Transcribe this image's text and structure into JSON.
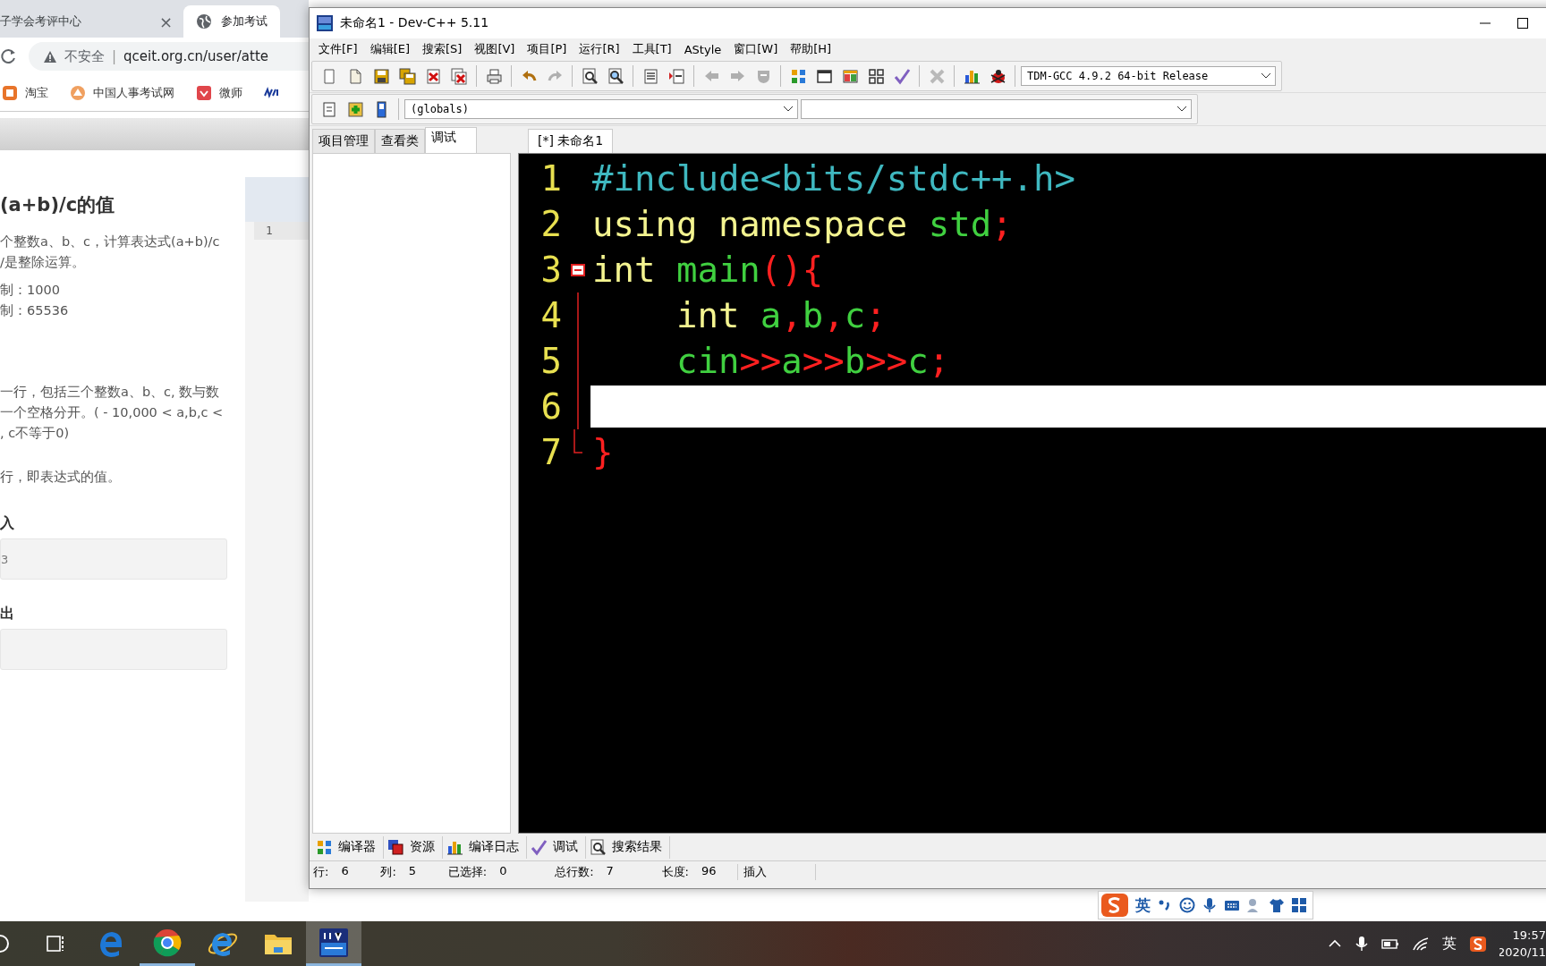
{
  "browser": {
    "tabs": [
      {
        "label": "子学会考评中心",
        "close": "×",
        "selected": false
      },
      {
        "label": "参加考试",
        "selected": true
      }
    ],
    "address": {
      "security": "不安全",
      "separator": "|",
      "url": "qceit.org.cn/user/atte"
    },
    "bookmarks": [
      "淘宝",
      "中国人事考试网",
      "微师"
    ],
    "problem": {
      "title": "(a+b)/c的值",
      "description": [
        "个整数a、b、c，计算表达式(a+b)/c",
        "/是整除运算。"
      ],
      "limits": [
        "制：1000",
        "制：65536"
      ],
      "input_description": [
        "一行，包括三个整数a、b、c, 数与数",
        "一个空格分开。( - 10,000 < a,b,c <",
        ", c不等于0)"
      ],
      "output_description": [
        "行，即表达式的值。"
      ],
      "sample_input": {
        "heading": "入",
        "value": "3"
      },
      "sample_output": {
        "heading": "出"
      }
    },
    "side_editor": {
      "line_numbers": [
        "1"
      ]
    }
  },
  "devcpp": {
    "title": "未命名1 - Dev-C++ 5.11",
    "menu": [
      "文件[F]",
      "编辑[E]",
      "搜索[S]",
      "视图[V]",
      "项目[P]",
      "运行[R]",
      "工具[T]",
      "AStyle",
      "窗口[W]",
      "帮助[H]"
    ],
    "toolbar": [
      {
        "kind": "new",
        "disabled": false
      },
      {
        "kind": "open",
        "disabled": false
      },
      {
        "kind": "save",
        "disabled": false
      },
      {
        "kind": "save-all",
        "disabled": false
      },
      {
        "kind": "close",
        "disabled": false
      },
      {
        "kind": "close-all",
        "disabled": false
      },
      {
        "kind": "separator"
      },
      {
        "kind": "print",
        "disabled": false
      },
      {
        "kind": "separator"
      },
      {
        "kind": "undo",
        "disabled": false
      },
      {
        "kind": "redo",
        "disabled": true
      },
      {
        "kind": "separator"
      },
      {
        "kind": "find",
        "disabled": false
      },
      {
        "kind": "replace",
        "disabled": false
      },
      {
        "kind": "separator"
      },
      {
        "kind": "list",
        "disabled": false
      },
      {
        "kind": "indent",
        "disabled": false
      },
      {
        "kind": "separator"
      },
      {
        "kind": "back",
        "disabled": true
      },
      {
        "kind": "forward",
        "disabled": true
      },
      {
        "kind": "shield",
        "disabled": true
      },
      {
        "kind": "separator"
      },
      {
        "kind": "tiles",
        "disabled": false
      },
      {
        "kind": "window",
        "disabled": false
      },
      {
        "kind": "color-window",
        "disabled": false
      },
      {
        "kind": "grid",
        "disabled": false
      },
      {
        "kind": "check",
        "disabled": false
      },
      {
        "kind": "separator"
      },
      {
        "kind": "cross",
        "disabled": true
      },
      {
        "kind": "separator"
      },
      {
        "kind": "chart",
        "disabled": false
      },
      {
        "kind": "bug",
        "disabled": false
      }
    ],
    "compiler": "TDM-GCC 4.9.2 64-bit Release",
    "scope": "(globals)",
    "side_tabs": [
      {
        "label": "项目管理",
        "selected": false
      },
      {
        "label": "查看类",
        "selected": false
      },
      {
        "label": "调试",
        "selected": true
      }
    ],
    "editor_tabs": [
      {
        "label": "[*] 未命名1",
        "selected": true
      }
    ],
    "code": [
      {
        "number": "1",
        "current": false,
        "kind": "plain",
        "tokens": [
          {
            "kind": "preproc",
            "text": "#include<bits/stdc++.h>"
          }
        ]
      },
      {
        "number": "2",
        "current": false,
        "kind": "plain",
        "tokens": [
          {
            "kind": "keyword",
            "text": "using namespace"
          },
          {
            "kind": "ident",
            "text": " std"
          },
          {
            "kind": "punct",
            "text": ";"
          }
        ]
      },
      {
        "number": "3",
        "current": false,
        "kind": "fold-start",
        "tokens": [
          {
            "kind": "keyword",
            "text": "int"
          },
          {
            "kind": "ident",
            "text": " main"
          },
          {
            "kind": "punct",
            "text": "(){"
          }
        ]
      },
      {
        "number": "4",
        "current": false,
        "kind": "fold-body",
        "tokens": [
          {
            "kind": "keyword",
            "text": "    int"
          },
          {
            "kind": "ident",
            "text": " a"
          },
          {
            "kind": "punct",
            "text": ","
          },
          {
            "kind": "ident",
            "text": "b"
          },
          {
            "kind": "punct",
            "text": ","
          },
          {
            "kind": "ident",
            "text": "c"
          },
          {
            "kind": "punct",
            "text": ";"
          }
        ]
      },
      {
        "number": "5",
        "current": false,
        "kind": "fold-body",
        "tokens": [
          {
            "kind": "ident",
            "text": "    cin"
          },
          {
            "kind": "punct",
            "text": ">>"
          },
          {
            "kind": "ident",
            "text": "a"
          },
          {
            "kind": "punct",
            "text": ">>"
          },
          {
            "kind": "ident",
            "text": "b"
          },
          {
            "kind": "punct",
            "text": ">>"
          },
          {
            "kind": "ident",
            "text": "c"
          },
          {
            "kind": "punct",
            "text": ";"
          }
        ]
      },
      {
        "number": "6",
        "current": true,
        "kind": "fold-body"
      },
      {
        "number": "7",
        "current": false,
        "kind": "fold-end",
        "tokens": [
          {
            "kind": "punct",
            "text": "}"
          }
        ]
      }
    ],
    "bottom_tabs": [
      {
        "label": "编译器",
        "kind": "tiles"
      },
      {
        "label": "资源",
        "kind": "copy"
      },
      {
        "label": "编译日志",
        "kind": "chart"
      },
      {
        "label": "调试",
        "kind": "check"
      },
      {
        "label": "搜索结果",
        "kind": "find"
      }
    ],
    "status": [
      {
        "label": "行:",
        "value": "6"
      },
      {
        "label": "列:",
        "value": "5"
      },
      {
        "label": "已选择:",
        "value": "0"
      },
      {
        "label": "总行数:",
        "value": "7"
      },
      {
        "label": "长度:",
        "value": "96"
      },
      {
        "label": "插入"
      }
    ]
  },
  "ime": {
    "language": "英"
  },
  "taskbar": {
    "apps": [
      {
        "kind": "edge",
        "running": false,
        "active": false
      },
      {
        "kind": "chrome",
        "running": true,
        "active": false
      },
      {
        "kind": "ie",
        "running": false,
        "active": false
      },
      {
        "kind": "explorer",
        "running": false,
        "active": false
      },
      {
        "kind": "devcpp",
        "running": true,
        "active": true
      }
    ],
    "tray_language": "英",
    "time": "19:57",
    "date": "2020/11"
  }
}
